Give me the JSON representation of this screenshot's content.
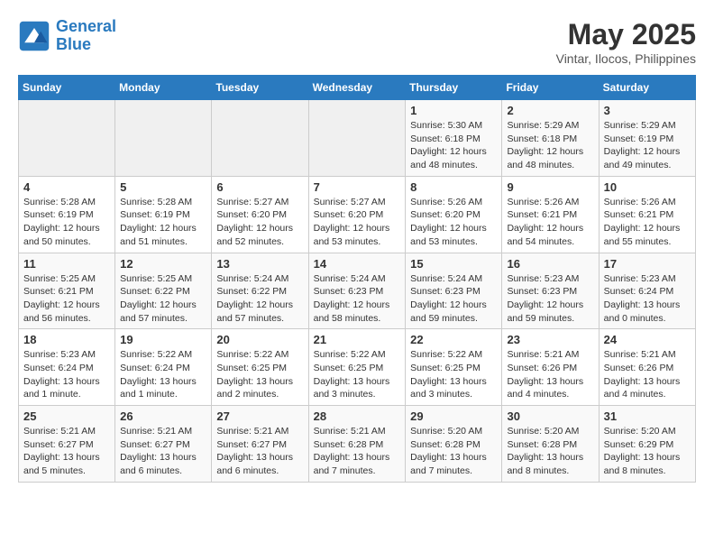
{
  "logo": {
    "line1": "General",
    "line2": "Blue"
  },
  "title": "May 2025",
  "location": "Vintar, Ilocos, Philippines",
  "days_of_week": [
    "Sunday",
    "Monday",
    "Tuesday",
    "Wednesday",
    "Thursday",
    "Friday",
    "Saturday"
  ],
  "weeks": [
    [
      {
        "day": "",
        "info": ""
      },
      {
        "day": "",
        "info": ""
      },
      {
        "day": "",
        "info": ""
      },
      {
        "day": "",
        "info": ""
      },
      {
        "day": "1",
        "info": "Sunrise: 5:30 AM\nSunset: 6:18 PM\nDaylight: 12 hours\nand 48 minutes."
      },
      {
        "day": "2",
        "info": "Sunrise: 5:29 AM\nSunset: 6:18 PM\nDaylight: 12 hours\nand 48 minutes."
      },
      {
        "day": "3",
        "info": "Sunrise: 5:29 AM\nSunset: 6:19 PM\nDaylight: 12 hours\nand 49 minutes."
      }
    ],
    [
      {
        "day": "4",
        "info": "Sunrise: 5:28 AM\nSunset: 6:19 PM\nDaylight: 12 hours\nand 50 minutes."
      },
      {
        "day": "5",
        "info": "Sunrise: 5:28 AM\nSunset: 6:19 PM\nDaylight: 12 hours\nand 51 minutes."
      },
      {
        "day": "6",
        "info": "Sunrise: 5:27 AM\nSunset: 6:20 PM\nDaylight: 12 hours\nand 52 minutes."
      },
      {
        "day": "7",
        "info": "Sunrise: 5:27 AM\nSunset: 6:20 PM\nDaylight: 12 hours\nand 53 minutes."
      },
      {
        "day": "8",
        "info": "Sunrise: 5:26 AM\nSunset: 6:20 PM\nDaylight: 12 hours\nand 53 minutes."
      },
      {
        "day": "9",
        "info": "Sunrise: 5:26 AM\nSunset: 6:21 PM\nDaylight: 12 hours\nand 54 minutes."
      },
      {
        "day": "10",
        "info": "Sunrise: 5:26 AM\nSunset: 6:21 PM\nDaylight: 12 hours\nand 55 minutes."
      }
    ],
    [
      {
        "day": "11",
        "info": "Sunrise: 5:25 AM\nSunset: 6:21 PM\nDaylight: 12 hours\nand 56 minutes."
      },
      {
        "day": "12",
        "info": "Sunrise: 5:25 AM\nSunset: 6:22 PM\nDaylight: 12 hours\nand 57 minutes."
      },
      {
        "day": "13",
        "info": "Sunrise: 5:24 AM\nSunset: 6:22 PM\nDaylight: 12 hours\nand 57 minutes."
      },
      {
        "day": "14",
        "info": "Sunrise: 5:24 AM\nSunset: 6:23 PM\nDaylight: 12 hours\nand 58 minutes."
      },
      {
        "day": "15",
        "info": "Sunrise: 5:24 AM\nSunset: 6:23 PM\nDaylight: 12 hours\nand 59 minutes."
      },
      {
        "day": "16",
        "info": "Sunrise: 5:23 AM\nSunset: 6:23 PM\nDaylight: 12 hours\nand 59 minutes."
      },
      {
        "day": "17",
        "info": "Sunrise: 5:23 AM\nSunset: 6:24 PM\nDaylight: 13 hours\nand 0 minutes."
      }
    ],
    [
      {
        "day": "18",
        "info": "Sunrise: 5:23 AM\nSunset: 6:24 PM\nDaylight: 13 hours\nand 1 minute."
      },
      {
        "day": "19",
        "info": "Sunrise: 5:22 AM\nSunset: 6:24 PM\nDaylight: 13 hours\nand 1 minute."
      },
      {
        "day": "20",
        "info": "Sunrise: 5:22 AM\nSunset: 6:25 PM\nDaylight: 13 hours\nand 2 minutes."
      },
      {
        "day": "21",
        "info": "Sunrise: 5:22 AM\nSunset: 6:25 PM\nDaylight: 13 hours\nand 3 minutes."
      },
      {
        "day": "22",
        "info": "Sunrise: 5:22 AM\nSunset: 6:25 PM\nDaylight: 13 hours\nand 3 minutes."
      },
      {
        "day": "23",
        "info": "Sunrise: 5:21 AM\nSunset: 6:26 PM\nDaylight: 13 hours\nand 4 minutes."
      },
      {
        "day": "24",
        "info": "Sunrise: 5:21 AM\nSunset: 6:26 PM\nDaylight: 13 hours\nand 4 minutes."
      }
    ],
    [
      {
        "day": "25",
        "info": "Sunrise: 5:21 AM\nSunset: 6:27 PM\nDaylight: 13 hours\nand 5 minutes."
      },
      {
        "day": "26",
        "info": "Sunrise: 5:21 AM\nSunset: 6:27 PM\nDaylight: 13 hours\nand 6 minutes."
      },
      {
        "day": "27",
        "info": "Sunrise: 5:21 AM\nSunset: 6:27 PM\nDaylight: 13 hours\nand 6 minutes."
      },
      {
        "day": "28",
        "info": "Sunrise: 5:21 AM\nSunset: 6:28 PM\nDaylight: 13 hours\nand 7 minutes."
      },
      {
        "day": "29",
        "info": "Sunrise: 5:20 AM\nSunset: 6:28 PM\nDaylight: 13 hours\nand 7 minutes."
      },
      {
        "day": "30",
        "info": "Sunrise: 5:20 AM\nSunset: 6:28 PM\nDaylight: 13 hours\nand 8 minutes."
      },
      {
        "day": "31",
        "info": "Sunrise: 5:20 AM\nSunset: 6:29 PM\nDaylight: 13 hours\nand 8 minutes."
      }
    ]
  ]
}
